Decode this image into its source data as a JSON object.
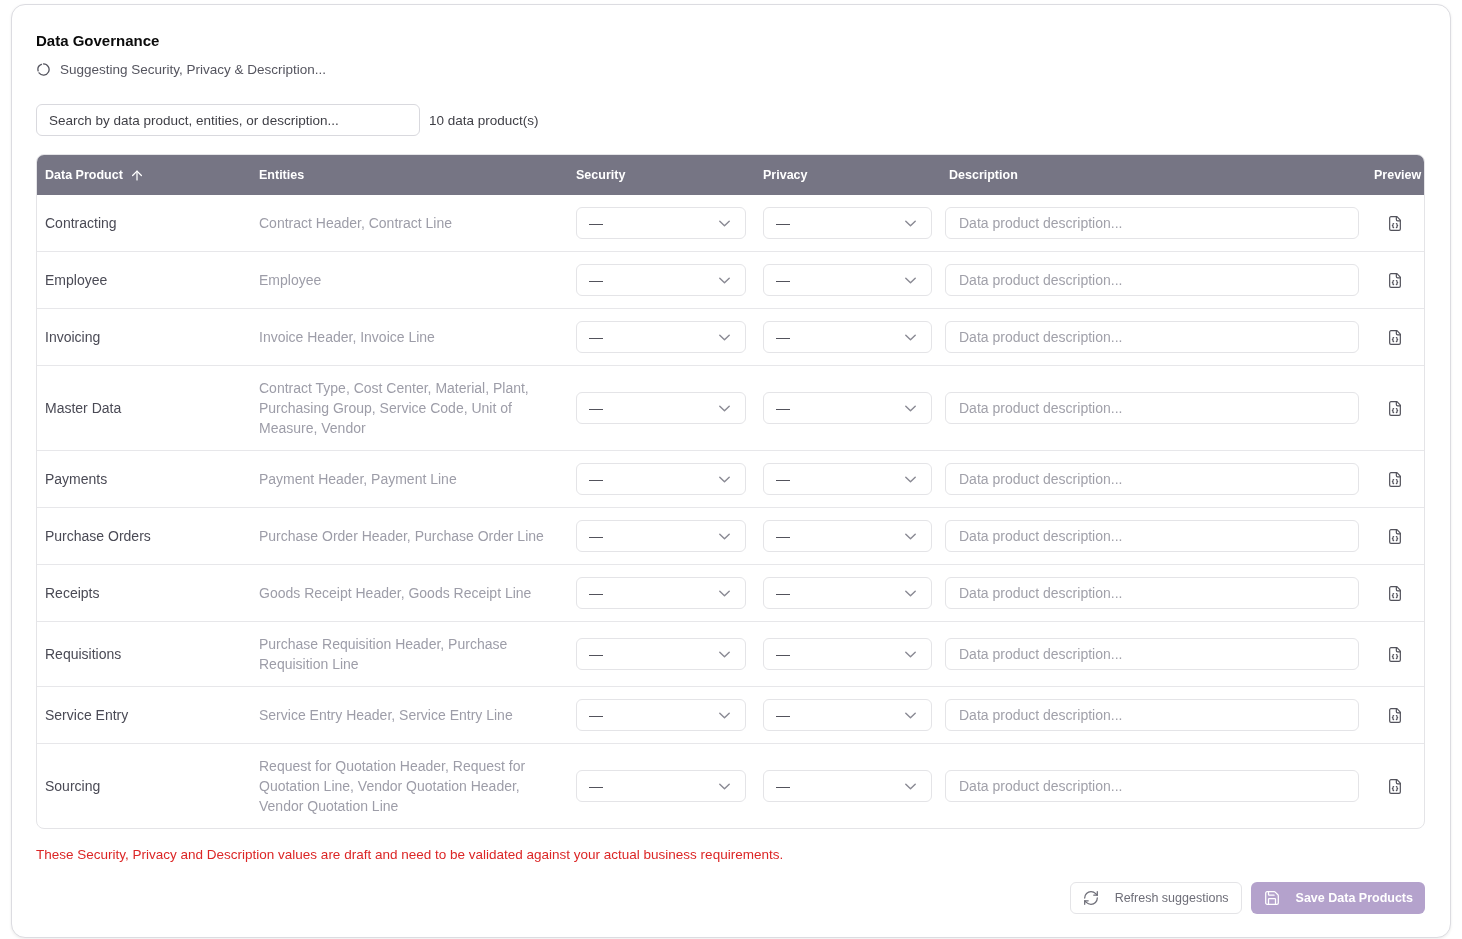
{
  "card": {
    "title": "Data Governance",
    "status": {
      "text": "Suggesting Security, Privacy & Description...",
      "loading": true
    }
  },
  "search": {
    "placeholder": "Search by data product, entities, or description..."
  },
  "count": "10 data product(s)",
  "table": {
    "columns": [
      {
        "label": "Data Product",
        "sorted": true
      },
      {
        "label": "Entities",
        "sorted": false
      },
      {
        "label": "Security",
        "sorted": false
      },
      {
        "label": "Privacy",
        "sorted": false
      },
      {
        "label": "Description",
        "sorted": false
      },
      {
        "label": "Preview",
        "sorted": false
      }
    ],
    "rows": [
      {
        "data_product": "Contracting",
        "entities": "Contract Header, Contract Line",
        "security": "—",
        "privacy": "—",
        "description": {
          "placeholder": "Data product description..."
        }
      },
      {
        "data_product": "Employee",
        "entities": "Employee",
        "security": "—",
        "privacy": "—",
        "description": {
          "placeholder": "Data product description..."
        }
      },
      {
        "data_product": "Invoicing",
        "entities": "Invoice Header, Invoice Line",
        "security": "—",
        "privacy": "—",
        "description": {
          "placeholder": "Data product description..."
        }
      },
      {
        "data_product": "Master Data",
        "entities": "Contract Type, Cost Center, Material, Plant, Purchasing Group, Service Code, Unit of Measure, Vendor",
        "security": "—",
        "privacy": "—",
        "description": {
          "placeholder": "Data product description..."
        }
      },
      {
        "data_product": "Payments",
        "entities": "Payment Header, Payment Line",
        "security": "—",
        "privacy": "—",
        "description": {
          "placeholder": "Data product description..."
        }
      },
      {
        "data_product": "Purchase Orders",
        "entities": "Purchase Order Header, Purchase Order Line",
        "security": "—",
        "privacy": "—",
        "description": {
          "placeholder": "Data product description..."
        }
      },
      {
        "data_product": "Receipts",
        "entities": "Goods Receipt Header, Goods Receipt Line",
        "security": "—",
        "privacy": "—",
        "description": {
          "placeholder": "Data product description..."
        }
      },
      {
        "data_product": "Requisitions",
        "entities": "Purchase Requisition Header, Purchase Requisition Line",
        "security": "—",
        "privacy": "—",
        "description": {
          "placeholder": "Data product description..."
        }
      },
      {
        "data_product": "Service Entry",
        "entities": "Service Entry Header, Service Entry Line",
        "security": "—",
        "privacy": "—",
        "description": {
          "placeholder": "Data product description..."
        }
      },
      {
        "data_product": "Sourcing",
        "entities": "Request for Quotation Header, Request for Quotation Line, Vendor Quotation Header, Vendor Quotation Line",
        "security": "—",
        "privacy": "—",
        "description": {
          "placeholder": "Data product description..."
        }
      }
    ]
  },
  "warning": "These Security, Privacy and Description values are draft and need to be validated against your actual business requirements.",
  "buttons": [
    {
      "label": "Refresh suggestions",
      "kind": "refresh",
      "disabled": true
    },
    {
      "label": "Save Data Products",
      "kind": "save",
      "disabled": true
    }
  ]
}
